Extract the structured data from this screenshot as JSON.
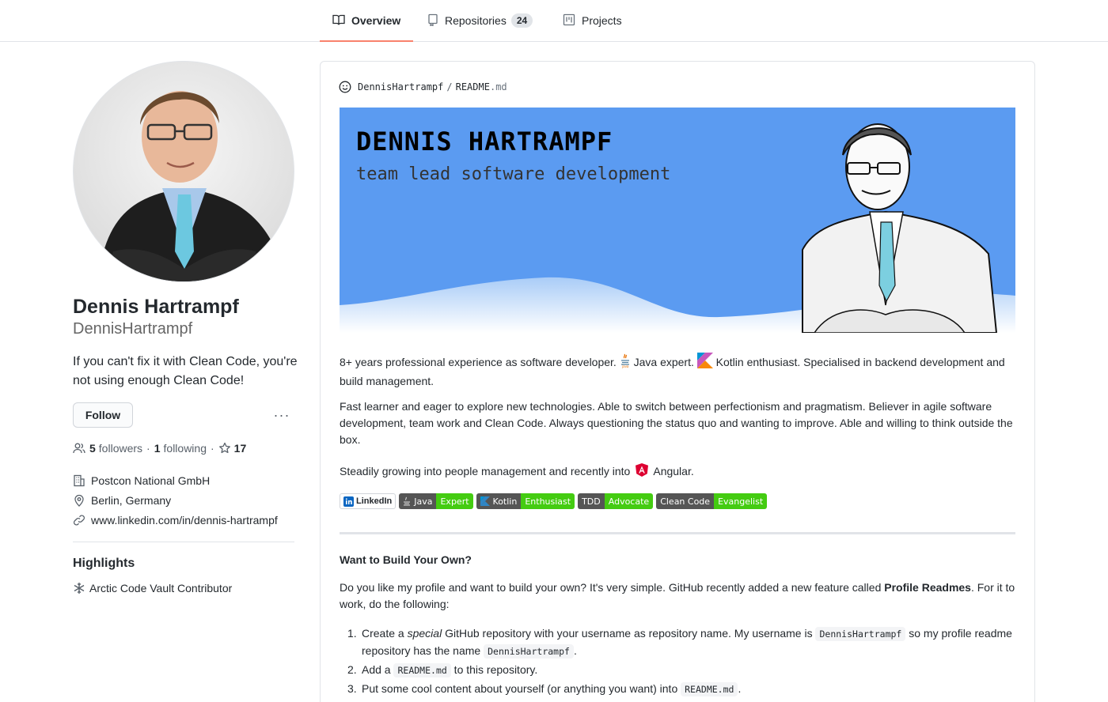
{
  "nav": {
    "tabs": [
      {
        "label": "Overview",
        "icon": "book-icon",
        "active": true
      },
      {
        "label": "Repositories",
        "icon": "repo-icon",
        "count": "24"
      },
      {
        "label": "Projects",
        "icon": "project-icon"
      }
    ]
  },
  "profile": {
    "full_name": "Dennis Hartrampf",
    "username": "DennisHartrampf",
    "bio": "If you can't fix it with Clean Code, you're not using enough Clean Code!",
    "follow_label": "Follow",
    "more_label": "···",
    "followers_count": "5",
    "followers_label": "followers",
    "following_count": "1",
    "following_label": "following",
    "stars_count": "17",
    "stats_sep": "·",
    "company": "Postcon National GmbH",
    "location": "Berlin, Germany",
    "website": "www.linkedin.com/in/dennis-hartrampf"
  },
  "highlights": {
    "title": "Highlights",
    "item": "Arctic Code Vault Contributor"
  },
  "readme": {
    "owner": "DennisHartrampf",
    "sep": "/",
    "file_base": "README",
    "file_ext": ".md",
    "banner_name": "DENNIS HARTRAMPF",
    "banner_tagline": "team lead software development",
    "p1_a": "8+ years professional experience as software developer.",
    "p1_b": "Java expert.",
    "p1_c": "Kotlin enthusiast. Specialised in backend development and build management.",
    "p2": "Fast learner and eager to explore new technologies. Able to switch between perfectionism and pragmatism. Believer in agile software development, team work and Clean Code. Always questioning the status quo and wanting to improve. Able and willing to think outside the box.",
    "p3_a": "Steadily growing into people management and recently into",
    "p3_b": "Angular.",
    "badges": [
      {
        "label": "LinkedIn"
      },
      {
        "left": "Java",
        "right": "Expert"
      },
      {
        "left": "Kotlin",
        "right": "Enthusiast"
      },
      {
        "left": "TDD",
        "right": "Advocate"
      },
      {
        "left": "Clean Code",
        "right": "Evangelist"
      }
    ],
    "h3": "Want to Build Your Own?",
    "p4_a": "Do you like my profile and want to build your own? It's very simple. GitHub recently added a new feature called ",
    "p4_b": "Profile Readmes",
    "p4_c": ". For it to work, do the following:",
    "list": [
      {
        "num": "1.",
        "a": "Create a ",
        "em": "special",
        "b": " GitHub repository with your username as repository name. My username is ",
        "code1": "DennisHartrampf",
        "c": " so my profile readme repository has the name ",
        "code2": "DennisHartrampf",
        "d": "."
      },
      {
        "num": "2.",
        "a": "Add a ",
        "code1": "README.md",
        "b": " to this repository."
      },
      {
        "num": "3.",
        "a": "Put some cool content about yourself (or anything you want) into ",
        "code1": "README.md",
        "b": "."
      }
    ]
  }
}
